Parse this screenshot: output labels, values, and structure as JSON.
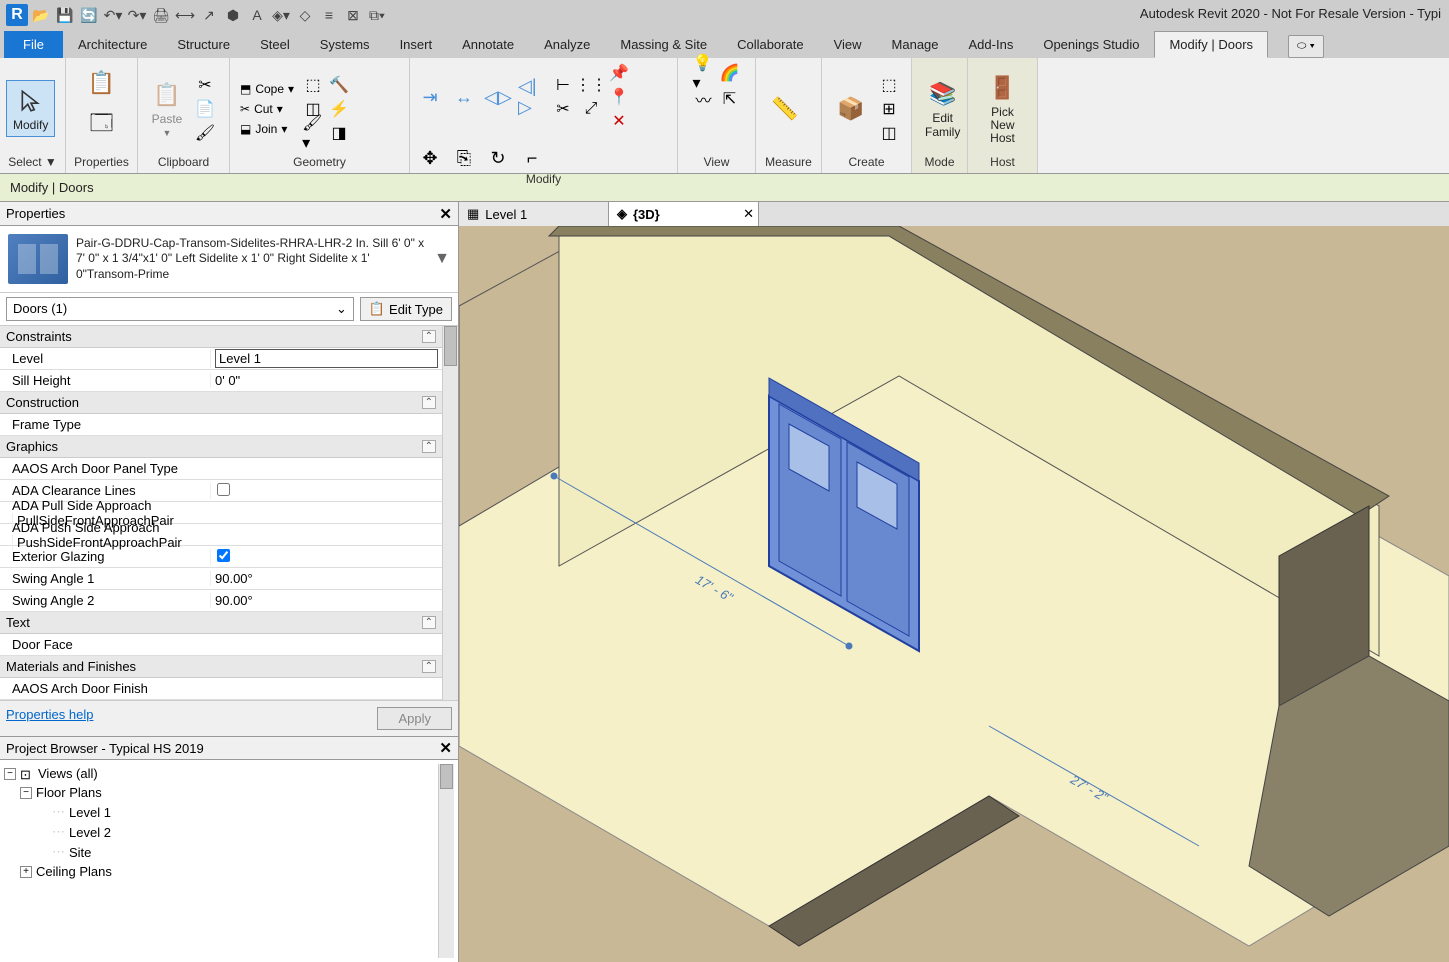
{
  "app_title": "Autodesk Revit 2020 - Not For Resale Version - Typi",
  "ribbon_tabs": [
    "File",
    "Architecture",
    "Structure",
    "Steel",
    "Systems",
    "Insert",
    "Annotate",
    "Analyze",
    "Massing & Site",
    "Collaborate",
    "View",
    "Manage",
    "Add-Ins",
    "Openings Studio",
    "Modify | Doors"
  ],
  "active_tab": "Modify | Doors",
  "panels": {
    "select": {
      "label": "Select ▼",
      "modify_btn": "Modify"
    },
    "properties": {
      "label": "Properties"
    },
    "clipboard": {
      "label": "Clipboard",
      "paste": "Paste"
    },
    "geometry": {
      "label": "Geometry",
      "cope": "Cope",
      "cut": "Cut",
      "join": "Join"
    },
    "modify": {
      "label": "Modify"
    },
    "view": {
      "label": "View"
    },
    "measure": {
      "label": "Measure"
    },
    "create": {
      "label": "Create"
    },
    "mode": {
      "label": "Mode",
      "edit_family": "Edit\nFamily"
    },
    "host": {
      "label": "Host",
      "pick_host": "Pick\nNew Host"
    }
  },
  "options_bar": "Modify | Doors",
  "properties_panel": {
    "title": "Properties",
    "type_name": "Pair-G-DDRU-Cap-Transom-Sidelites-RHRA-LHR-2 In. Sill 6' 0\" x 7' 0\" x 1 3/4\"x1' 0\" Left Sidelite x 1' 0\" Right Sidelite x 1' 0\"Transom-Prime",
    "instance_filter": "Doors (1)",
    "edit_type": "Edit Type",
    "categories": [
      {
        "name": "Constraints",
        "rows": [
          {
            "name": "Level",
            "value": "Level 1",
            "editable": true
          },
          {
            "name": "Sill Height",
            "value": "0'  0\""
          }
        ]
      },
      {
        "name": "Construction",
        "rows": [
          {
            "name": "Frame Type",
            "value": ""
          }
        ]
      },
      {
        "name": "Graphics",
        "rows": [
          {
            "name": "AAOS Arch Door Panel Type",
            "value": ""
          },
          {
            "name": "ADA Clearance Lines",
            "value": false,
            "checkbox": true
          },
          {
            "name": "ADA Pull Side Approach<Gene…",
            "value": "PullSideFrontApproachPair"
          },
          {
            "name": "ADA Push Side Approach<Gen…",
            "value": "PushSideFrontApproachPair"
          },
          {
            "name": "Exterior Glazing",
            "value": true,
            "checkbox": true
          },
          {
            "name": "Swing Angle 1",
            "value": "90.00°"
          },
          {
            "name": "Swing Angle 2",
            "value": "90.00°"
          }
        ]
      },
      {
        "name": "Text",
        "rows": [
          {
            "name": "Door Face",
            "value": ""
          }
        ]
      },
      {
        "name": "Materials and Finishes",
        "rows": [
          {
            "name": "AAOS Arch Door Finish",
            "value": ""
          }
        ]
      }
    ],
    "help": "Properties help",
    "apply": "Apply"
  },
  "browser": {
    "title": "Project Browser - Typical HS 2019",
    "root": "Views (all)",
    "floor_plans": "Floor Plans",
    "levels": [
      "Level 1",
      "Level 2",
      "Site"
    ],
    "ceiling": "Ceiling Plans"
  },
  "view_tabs": [
    {
      "label": "Level 1",
      "active": false,
      "icon": "plan"
    },
    {
      "label": "{3D}",
      "active": true,
      "icon": "3d"
    }
  ],
  "dimensions": {
    "d1": "17' - 6\"",
    "d2": "27' - 2\""
  }
}
